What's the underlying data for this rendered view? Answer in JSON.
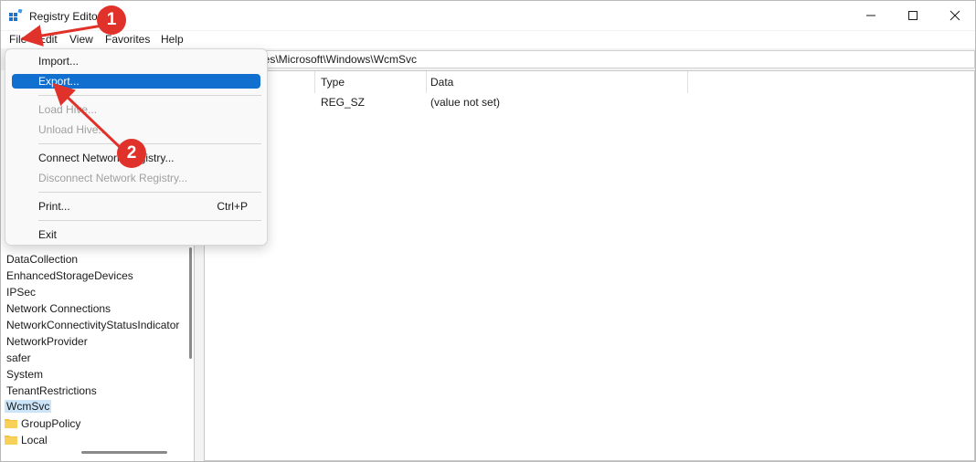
{
  "window": {
    "title": "Registry Editor",
    "controls": {
      "minimize": "minimize-icon",
      "maximize": "maximize-icon",
      "close": "close-icon"
    }
  },
  "menubar": {
    "items": [
      "File",
      "Edit",
      "View",
      "Favorites",
      "Help"
    ]
  },
  "address": {
    "path": "ies\\Microsoft\\Windows\\WcmSvc"
  },
  "list": {
    "columns": [
      "Type",
      "Data"
    ],
    "rows": [
      {
        "type": "REG_SZ",
        "data": "(value not set)"
      }
    ]
  },
  "tree": {
    "items": [
      "DataCollection",
      "EnhancedStorageDevices",
      "IPSec",
      "Network Connections",
      "NetworkConnectivityStatusIndicator",
      "NetworkProvider",
      "safer",
      "System",
      "TenantRestrictions",
      "WcmSvc"
    ],
    "selected": "WcmSvc",
    "folders": [
      "GroupPolicy",
      "Local"
    ]
  },
  "file_menu": {
    "items": [
      {
        "label": "Import...",
        "enabled": true
      },
      {
        "label": "Export...",
        "enabled": true,
        "highlighted": true
      },
      {
        "label": "Load Hive...",
        "enabled": false
      },
      {
        "label": "Unload Hive...",
        "enabled": false
      },
      {
        "label": "Connect Network Registry...",
        "enabled": true
      },
      {
        "label": "Disconnect Network Registry...",
        "enabled": false
      },
      {
        "label": "Print...",
        "enabled": true,
        "shortcut": "Ctrl+P"
      },
      {
        "label": "Exit",
        "enabled": true
      }
    ]
  },
  "annotations": {
    "step1": "1",
    "step2": "2",
    "color": "#e0322b"
  },
  "colors": {
    "highlight": "#1170cf",
    "selection": "#cce4f7",
    "folder": "#f5c242"
  }
}
